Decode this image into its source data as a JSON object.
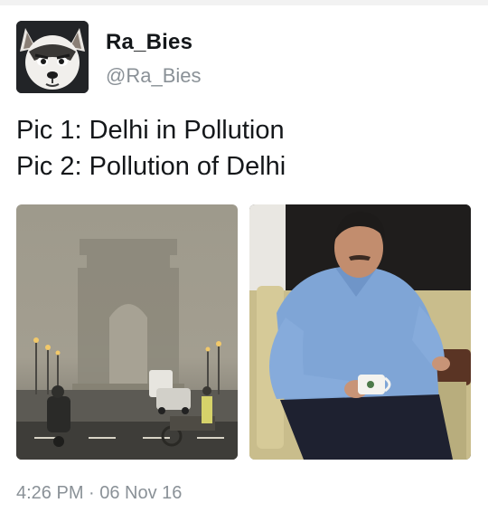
{
  "profile": {
    "display_name": "Ra_Bies",
    "handle": "@Ra_Bies",
    "avatar_icon": "husky-dog-face-icon"
  },
  "tweet": {
    "lines": [
      "Pic 1: Delhi in Pollution",
      "Pic 2: Pollution of Delhi"
    ]
  },
  "media": [
    {
      "semantic": "smoggy-india-gate-photo"
    },
    {
      "semantic": "man-in-blue-shirt-with-teacup-photo"
    }
  ],
  "meta": {
    "timestamp": "4:26 PM · 06 Nov 16"
  },
  "colors": {
    "text": "#14171a",
    "secondary": "#8a9197",
    "smog": "#9c9889"
  }
}
